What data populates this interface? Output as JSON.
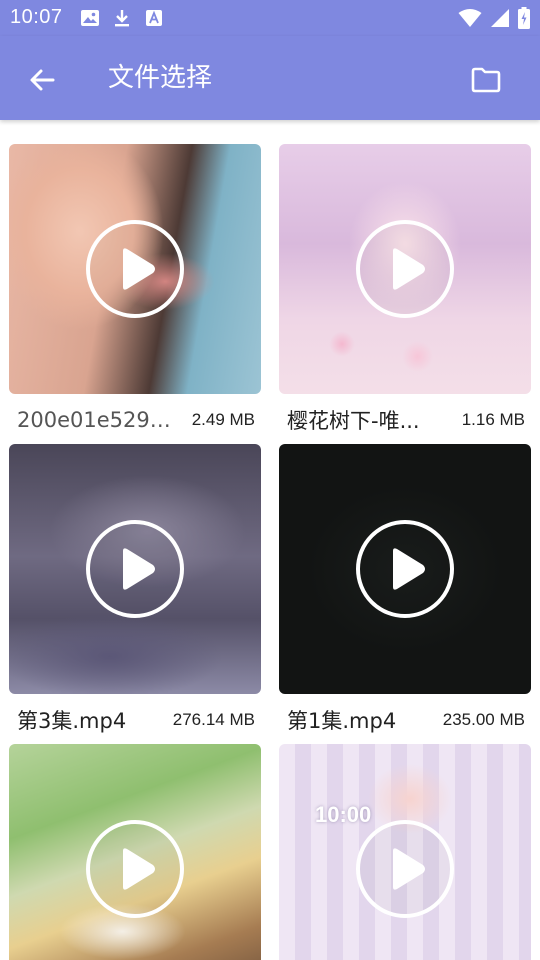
{
  "status_bar": {
    "time": "10:07",
    "left_icons": [
      "image-icon",
      "download-icon",
      "text-a-icon"
    ],
    "right_icons": [
      "wifi-icon",
      "signal-icon",
      "battery-icon"
    ]
  },
  "app_bar": {
    "title": "文件选择",
    "back_icon": "arrow-left-icon",
    "folder_icon": "folder-icon",
    "background": "#7F88E0"
  },
  "files": [
    {
      "name": "200e01e5297...",
      "size": "2.49 MB"
    },
    {
      "name": "樱花树下-唯...",
      "size": "1.16 MB"
    },
    {
      "name": "第3集.mp4",
      "size": "276.14 MB"
    },
    {
      "name": "第1集.mp4",
      "size": "235.00 MB"
    },
    {
      "name": "",
      "size": ""
    },
    {
      "name": "",
      "size": ""
    }
  ],
  "thumb_overlay_text": {
    "clock": "10:00"
  }
}
